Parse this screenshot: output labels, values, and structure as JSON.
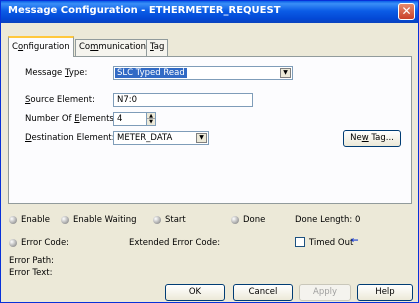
{
  "window": {
    "title": "Message Configuration - ETHERMETER_REQUEST"
  },
  "tabs": [
    {
      "label_pre": "C",
      "label_u": "o",
      "label_post": "nfiguration"
    },
    {
      "label_pre": "Co",
      "label_u": "m",
      "label_post": "munication"
    },
    {
      "label_pre": "",
      "label_u": "T",
      "label_post": "ag"
    }
  ],
  "config": {
    "message_type_label_pre": "Message ",
    "message_type_label_u": "T",
    "message_type_label_post": "ype:",
    "message_type_value": "SLC Typed Read",
    "source_element_label_u": "S",
    "source_element_label_post": "ource Element:",
    "source_element_value": "N7:0",
    "num_elements_label_pre": "Number Of ",
    "num_elements_label_u": "E",
    "num_elements_label_post": "lements:",
    "num_elements_value": "4",
    "dest_element_label_u": "D",
    "dest_element_label_post": "estination Element:",
    "dest_element_value": "METER_DATA",
    "new_tag_pre": "Ne",
    "new_tag_u": "w",
    "new_tag_post": " Tag..."
  },
  "status": {
    "enable": "Enable",
    "enable_waiting": "Enable Waiting",
    "start": "Start",
    "done": "Done",
    "done_length": "Done Length: 0",
    "error_code": "Error Code:",
    "extended_error_code": "Extended Error Code:",
    "timed_out": "Timed Out",
    "timed_out_arrow": "←",
    "error_path": "Error Path:",
    "error_text": "Error Text:"
  },
  "buttons": {
    "ok": "OK",
    "cancel": "Cancel",
    "apply": "Apply",
    "help": "Help"
  }
}
